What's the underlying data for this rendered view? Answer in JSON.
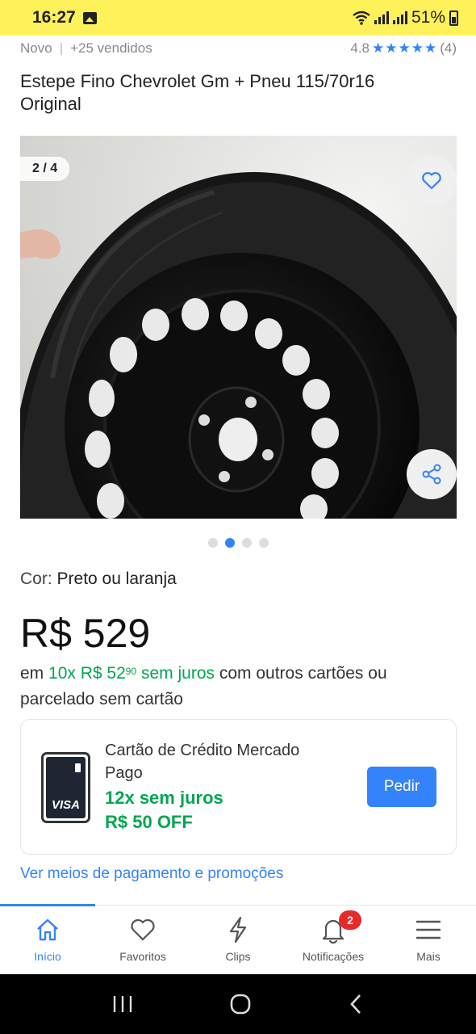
{
  "status_bar": {
    "time": "16:27",
    "battery": "51%"
  },
  "product": {
    "condition": "Novo",
    "sold": "+25 vendidos",
    "rating": "4.8",
    "rating_stars": 5,
    "reviews_count": "(4)",
    "title": "Estepe Fino Chevrolet Gm + Pneu 115/70r16 Original",
    "image_counter": "2 / 4",
    "image_description": "steel spare wheel with tire",
    "image_count": 4,
    "image_current": 2,
    "color_label": "Cor:",
    "color_value": "Preto ou laranja",
    "price": "R$ 529",
    "installments": {
      "prefix": "em",
      "count": "10x",
      "amount": "R$ 52",
      "cents": "90",
      "no_interest": "sem juros",
      "suffix": "com outros cartões ou parcelado sem cartão"
    }
  },
  "credit_card": {
    "title": "Cartão de Crédito Mercado Pago",
    "offer": "12x sem juros",
    "discount": "R$ 50 OFF",
    "button": "Pedir",
    "brand": "VISA"
  },
  "payment_link": "Ver meios de pagamento e promoções",
  "bottom_nav": {
    "items": [
      {
        "label": "Início",
        "icon": "home-icon",
        "active": true
      },
      {
        "label": "Favoritos",
        "icon": "heart-icon"
      },
      {
        "label": "Clips",
        "icon": "lightning-icon"
      },
      {
        "label": "Notificações",
        "icon": "bell-icon",
        "badge": "2"
      },
      {
        "label": "Mais",
        "icon": "menu-icon"
      }
    ]
  },
  "colors": {
    "brand_yellow": "#fff159",
    "accent_blue": "#3483fa",
    "green": "#00a650",
    "badge_red": "#e62a2a"
  }
}
